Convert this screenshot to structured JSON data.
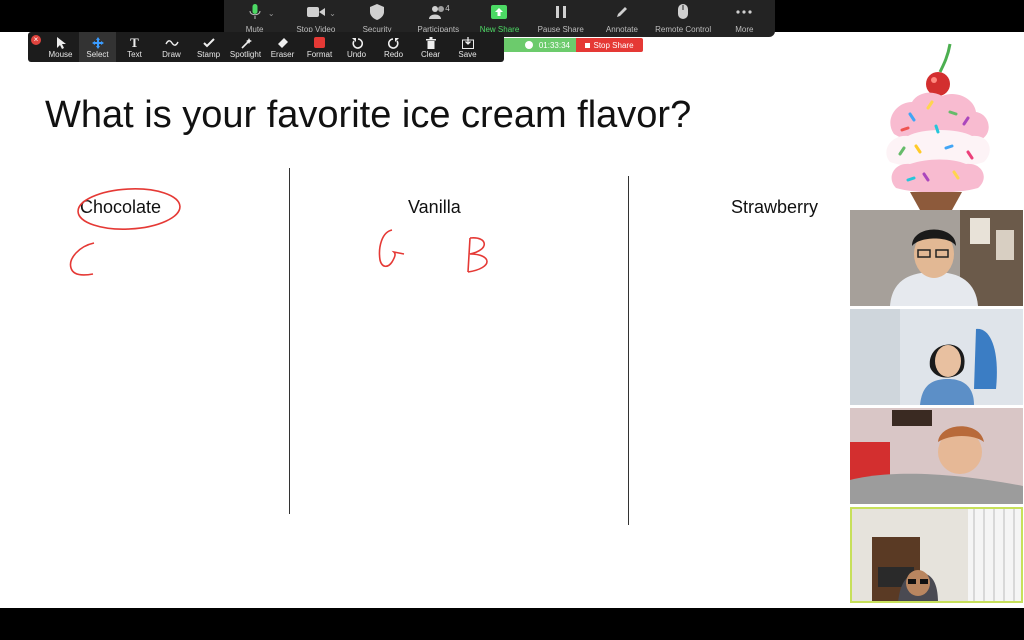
{
  "share_toolbar": {
    "items": [
      {
        "label": "Mute",
        "icon": "microphone-icon"
      },
      {
        "label": "Stop Video",
        "icon": "video-camera-icon"
      },
      {
        "label": "Security",
        "icon": "shield-icon"
      },
      {
        "label": "Participants",
        "icon": "participants-icon",
        "count": "4"
      },
      {
        "label": "New Share",
        "icon": "share-screen-icon"
      },
      {
        "label": "Pause Share",
        "icon": "pause-icon"
      },
      {
        "label": "Annotate",
        "icon": "pencil-icon"
      },
      {
        "label": "Remote Control",
        "icon": "mouse-icon"
      },
      {
        "label": "More",
        "icon": "more-icon"
      }
    ]
  },
  "annotate_toolbar": {
    "items": [
      {
        "label": "Mouse",
        "icon": "cursor-icon"
      },
      {
        "label": "Select",
        "icon": "move-icon"
      },
      {
        "label": "Text",
        "icon": "text-icon"
      },
      {
        "label": "Draw",
        "icon": "squiggle-icon"
      },
      {
        "label": "Stamp",
        "icon": "checkmark-icon"
      },
      {
        "label": "Spotlight",
        "icon": "wand-icon"
      },
      {
        "label": "Eraser",
        "icon": "eraser-icon"
      },
      {
        "label": "Format",
        "icon": "color-swatch-icon"
      },
      {
        "label": "Undo",
        "icon": "undo-icon"
      },
      {
        "label": "Redo",
        "icon": "redo-icon"
      },
      {
        "label": "Clear",
        "icon": "trash-icon"
      },
      {
        "label": "Save",
        "icon": "save-icon"
      }
    ],
    "selected": "Select",
    "format_color": "#e53935"
  },
  "share_status": {
    "timer": "01:33:34",
    "stop_label": "Stop Share"
  },
  "slide": {
    "question": "What is your favorite ice cream flavor?",
    "columns": [
      "Chocolate",
      "Vanilla",
      "Strawberry"
    ],
    "annotations": {
      "chocolate_marks": [
        "C"
      ],
      "vanilla_marks": [
        "G",
        "B"
      ],
      "ink_color": "#e53935"
    }
  },
  "participants": [
    {
      "name": "",
      "description": "man with glasses"
    },
    {
      "name": "",
      "description": "girl on phone"
    },
    {
      "name": "",
      "description": "girl lying down"
    },
    {
      "name": "",
      "description": "person with glasses and hood",
      "active_speaker": true
    }
  ],
  "colors": {
    "toolbar_bg": "#232323",
    "accent_green": "#4cd964",
    "stop_red": "#e53935",
    "active_outline": "#c7e05a"
  }
}
